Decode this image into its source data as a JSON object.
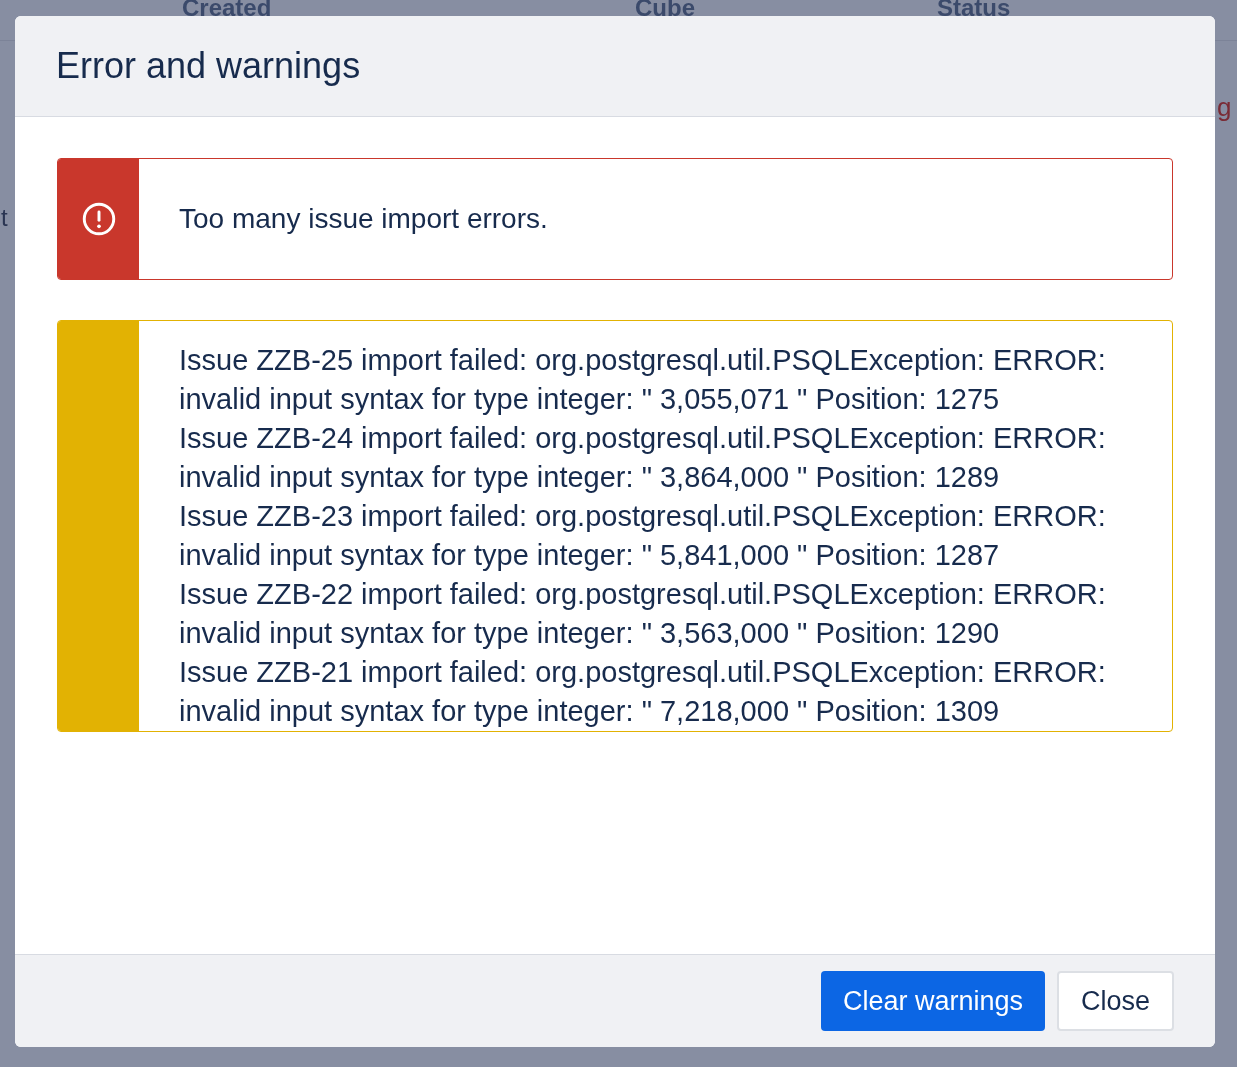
{
  "background": {
    "columns": [
      "Created",
      "Cube",
      "Status"
    ],
    "left_fragment": "t",
    "right_fragment": "g"
  },
  "dialog": {
    "title": "Error and warnings",
    "alerts": [
      {
        "kind": "error",
        "messages": [
          "Too many issue import errors."
        ]
      },
      {
        "kind": "warning",
        "messages": [
          "Issue ZZB-25 import failed: org.postgresql.util.PSQLException: ERROR: invalid input syntax for type integer: \" 3,055,071 \" Position: 1275",
          "Issue ZZB-24 import failed: org.postgresql.util.PSQLException: ERROR: invalid input syntax for type integer: \" 3,864,000 \" Position: 1289",
          "Issue ZZB-23 import failed: org.postgresql.util.PSQLException: ERROR: invalid input syntax for type integer: \" 5,841,000 \" Position: 1287",
          "Issue ZZB-22 import failed: org.postgresql.util.PSQLException: ERROR: invalid input syntax for type integer: \" 3,563,000 \" Position: 1290",
          "Issue ZZB-21 import failed: org.postgresql.util.PSQLException: ERROR: invalid input syntax for type integer: \" 7,218,000 \" Position: 1309"
        ]
      }
    ],
    "buttons": [
      {
        "label": "Clear warnings",
        "kind": "primary"
      },
      {
        "label": "Close",
        "kind": "secondary"
      }
    ]
  }
}
